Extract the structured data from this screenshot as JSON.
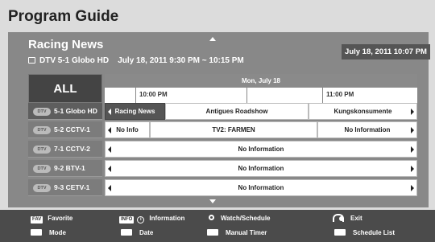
{
  "title": "Program Guide",
  "program": {
    "name": "Racing News",
    "channel": "DTV 5-1 Globo HD",
    "schedule": "July 18, 2011 9:30 PM ~ 10:15 PM"
  },
  "clock": "July 18, 2011 10:07 PM",
  "filter": "ALL",
  "timeline": {
    "date": "Mon, July 18",
    "slots": [
      "10:00 PM",
      "11:00 PM"
    ]
  },
  "channel_badge": "DTV",
  "rows": [
    {
      "channel": "5-1 Globo HD",
      "programs": [
        "Racing News",
        "Antigues Roadshow",
        "Kungskonsumente"
      ]
    },
    {
      "channel": "5-2 CCTV-1",
      "programs": [
        "No Info",
        "TV2: FARMEN",
        "No Information"
      ]
    },
    {
      "channel": "7-1 CCTV-2",
      "programs": [
        "No Information"
      ]
    },
    {
      "channel": "9-2 BTV-1",
      "programs": [
        "No Information"
      ]
    },
    {
      "channel": "9-3 CETV-1",
      "programs": [
        "No Information"
      ]
    }
  ],
  "legend": {
    "fav_key": "FAV",
    "favorite": "Favorite",
    "info_key": "INFO",
    "info_symbol": "i",
    "information": "Information",
    "watch": "Watch/Schedule",
    "exit": "Exit",
    "mode": "Mode",
    "date": "Date",
    "manual_timer": "Manual Timer",
    "schedule_list": "Schedule List"
  }
}
